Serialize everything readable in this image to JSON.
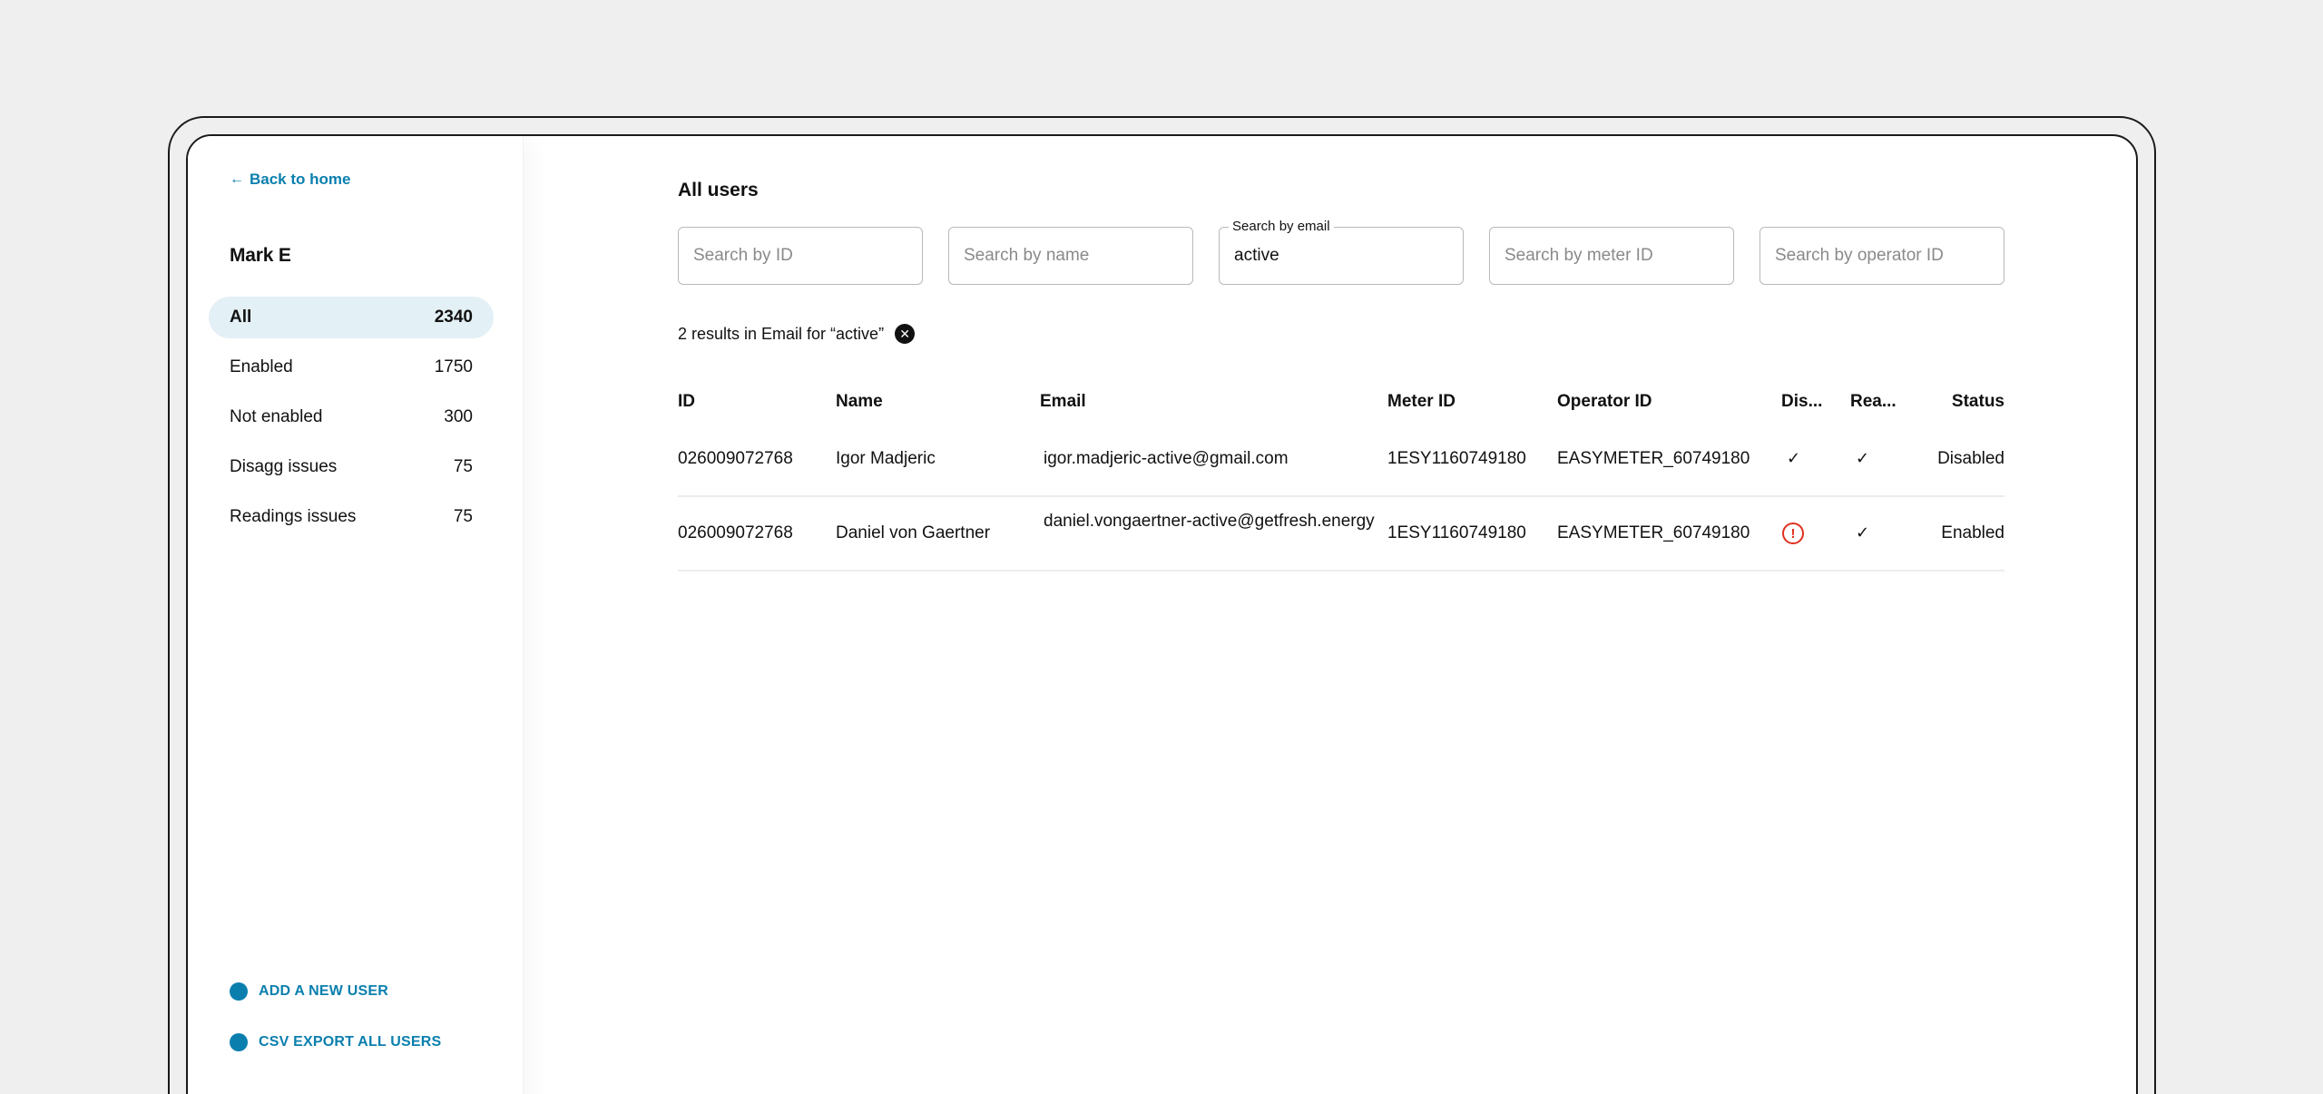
{
  "sidebar": {
    "back_label": "Back to home",
    "user_name": "Mark E",
    "filters": [
      {
        "label": "All",
        "count": "2340"
      },
      {
        "label": "Enabled",
        "count": "1750"
      },
      {
        "label": "Not enabled",
        "count": "300"
      },
      {
        "label": "Disagg issues",
        "count": "75"
      },
      {
        "label": "Readings issues",
        "count": "75"
      }
    ],
    "actions": [
      {
        "label": "ADD A NEW USER"
      },
      {
        "label": "CSV EXPORT ALL USERS"
      }
    ]
  },
  "main": {
    "title": "All users",
    "search": {
      "id_placeholder": "Search by ID",
      "name_placeholder": "Search by name",
      "email_label": "Search by email",
      "email_value": "active",
      "meter_placeholder": "Search by meter ID",
      "operator_placeholder": "Search by operator ID"
    },
    "results_text": "2 results in Email for “active”",
    "table": {
      "headers": {
        "id": "ID",
        "name": "Name",
        "email": "Email",
        "meter": "Meter ID",
        "operator": "Operator ID",
        "dis": "Dis...",
        "rea": "Rea...",
        "status": "Status"
      },
      "rows": [
        {
          "id": "026009072768",
          "name": "Igor Madjeric",
          "email": "igor.madjeric-active@gmail.com",
          "meter": "1ESY1160749180",
          "operator": "EASYMETER_60749180",
          "dis_icon": "check-icon",
          "rea_icon": "check-icon",
          "status": "Disabled"
        },
        {
          "id": "026009072768",
          "name": "Daniel von Gaertner",
          "email": "daniel.vongaertner-active@getfresh.energy",
          "meter": "1ESY1160749180",
          "operator": "EASYMETER_60749180",
          "dis_icon": "alert-circle-icon",
          "rea_icon": "check-icon",
          "status": "Enabled"
        }
      ]
    }
  },
  "colors": {
    "accent": "#0a7fae",
    "active_bg": "#e3f0f6",
    "warning": "#e0301e",
    "page_bg": "#efefef"
  }
}
